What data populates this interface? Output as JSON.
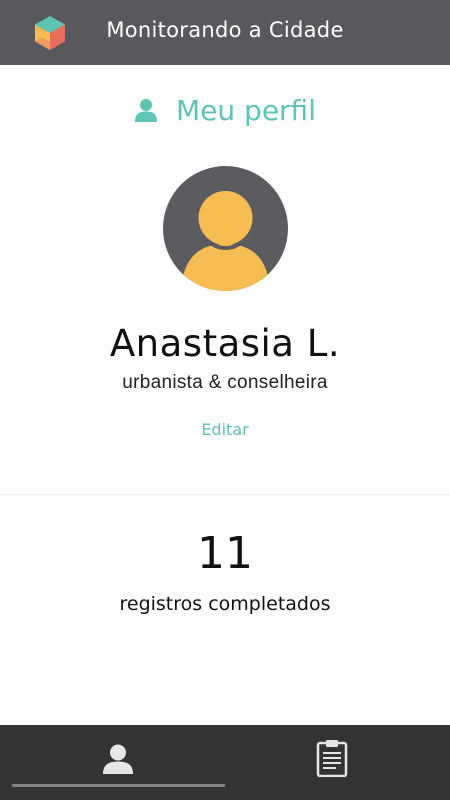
{
  "app_bar": {
    "title": "Monitorando a Cidade",
    "logo_icon": "hexagon-logo-icon",
    "colors": {
      "background": "#59595d",
      "logo_teal": "#5ec4b6",
      "logo_yellow": "#f5bd52",
      "logo_red": "#ea6e5e"
    }
  },
  "profile": {
    "heading": "Meu perfil",
    "heading_icon": "user-icon",
    "name": "Anastasia L.",
    "role": "urbanista & conselheira",
    "edit_label": "Editar",
    "avatar_icon": "person-avatar-icon",
    "colors": {
      "accent": "#5ec4b6",
      "avatar_bg": "#5b5b60",
      "avatar_person": "#f5bd52"
    }
  },
  "stats": {
    "count": "11",
    "label": "registros completados"
  },
  "bottom_nav": {
    "tabs": [
      {
        "name": "profile",
        "icon": "user-icon",
        "active": true
      },
      {
        "name": "records",
        "icon": "clipboard-icon",
        "active": false
      }
    ],
    "colors": {
      "background": "#333333",
      "icon": "#e6e6e6",
      "indicator": "#828282"
    }
  }
}
